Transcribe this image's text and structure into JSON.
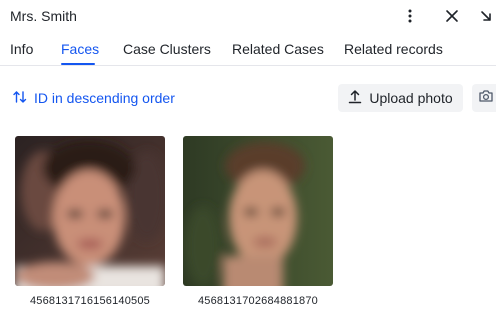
{
  "header": {
    "title": "Mrs. Smith",
    "icons": [
      "more-vertical-icon",
      "close-icon",
      "minimize-arrow-icon"
    ]
  },
  "tabs": [
    {
      "label": "Info",
      "active": false
    },
    {
      "label": "Faces",
      "active": true
    },
    {
      "label": "Case Clusters",
      "active": false
    },
    {
      "label": "Related Cases",
      "active": false
    },
    {
      "label": "Related records",
      "active": false
    }
  ],
  "toolbar": {
    "sort_label": "ID in descending order",
    "sort_icon": "sort-arrows-icon",
    "upload_label": "Upload photo",
    "upload_icon": "upload-icon",
    "camera_icon": "camera-icon"
  },
  "faces": [
    {
      "id": "4568131716156140505"
    },
    {
      "id": "4568131702684881870"
    }
  ],
  "colors": {
    "accent": "#1456f0",
    "text": "#1f2329",
    "button_bg": "#f2f3f5",
    "divider": "#e5e6eb"
  }
}
